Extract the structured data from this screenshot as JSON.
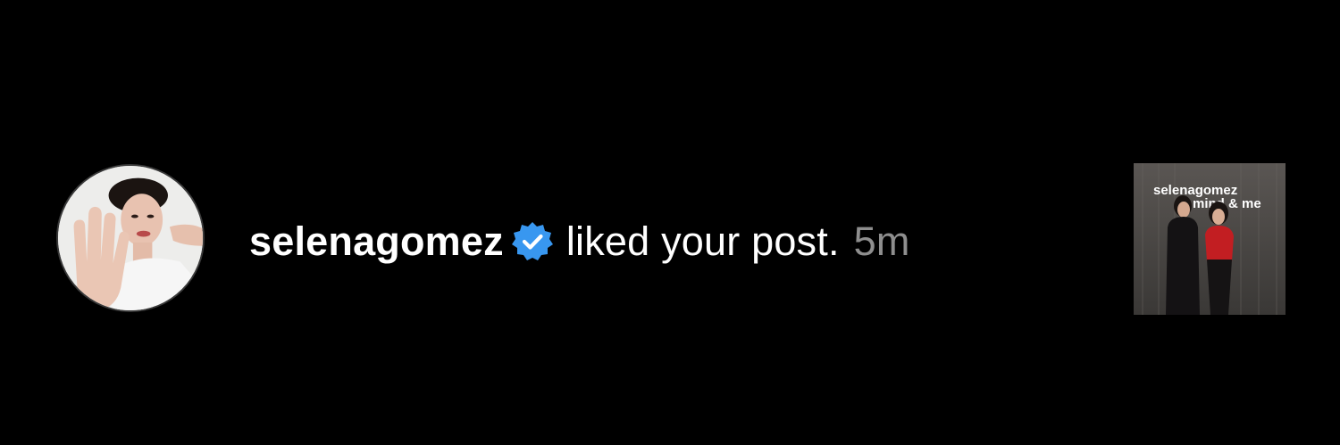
{
  "notification": {
    "username": "selenagomez",
    "action_text": "liked your post.",
    "time": "5m",
    "verified": true,
    "verified_color": "#3897F0",
    "avatar_icon": "profile-photo",
    "post_thumbnail": {
      "line1": "selenagomez",
      "line2": "mind & me"
    }
  },
  "colors": {
    "background": "#000000",
    "primary_text": "#FFFFFF",
    "secondary_text": "#8E8E8E"
  }
}
